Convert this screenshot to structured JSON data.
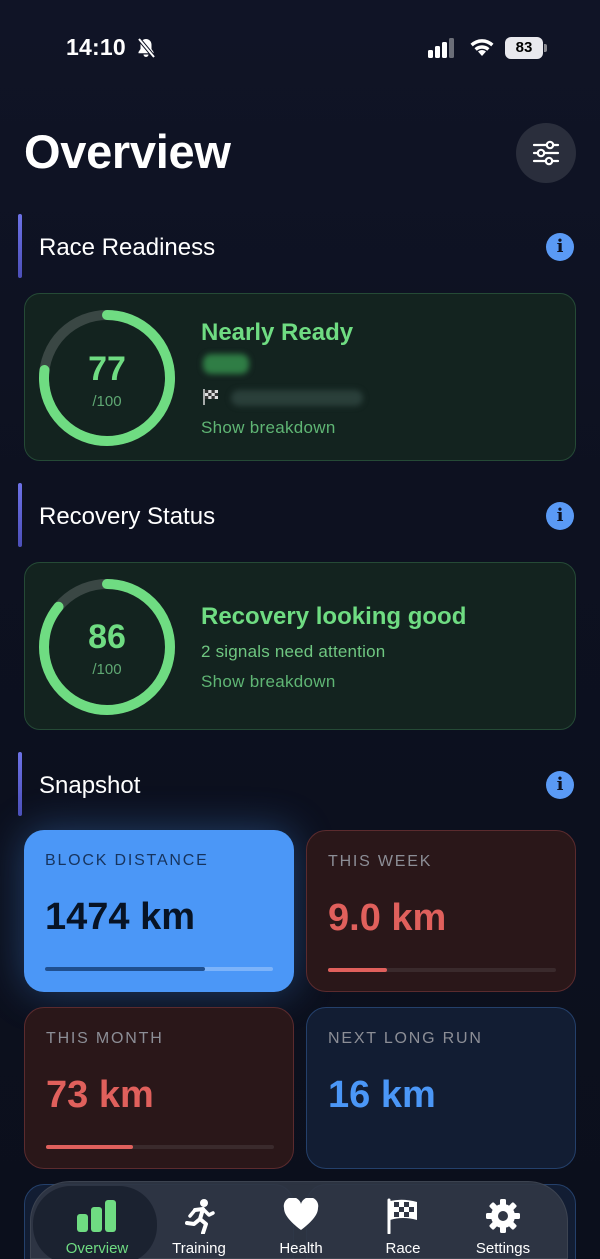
{
  "status_bar": {
    "time": "14:10",
    "battery": "83"
  },
  "header": {
    "title": "Overview"
  },
  "sections": {
    "race_readiness": "Race Readiness",
    "recovery_status": "Recovery Status",
    "snapshot": "Snapshot"
  },
  "race_card": {
    "score": "77",
    "max": "/100",
    "score_fraction": 0.77,
    "title": "Nearly Ready",
    "link": "Show breakdown"
  },
  "recovery_card": {
    "score": "86",
    "max": "/100",
    "score_fraction": 0.86,
    "title": "Recovery looking good",
    "subtitle": "2 signals need attention",
    "link": "Show breakdown"
  },
  "snapshot": {
    "block_distance": {
      "label": "BLOCK DISTANCE",
      "value": "1474 km",
      "progress": 0.7
    },
    "this_week": {
      "label": "THIS WEEK",
      "value": "9.0 km",
      "progress": 0.26
    },
    "this_month": {
      "label": "THIS MONTH",
      "value": "73 km",
      "progress": 0.38
    },
    "next_long_run": {
      "label": "NEXT LONG RUN",
      "value": "16 km"
    }
  },
  "tabs": [
    {
      "label": "Overview",
      "icon": "bar-chart-icon",
      "active": true
    },
    {
      "label": "Training",
      "icon": "runner-icon"
    },
    {
      "label": "Health",
      "icon": "heart-icon"
    },
    {
      "label": "Race",
      "icon": "checkered-flag-icon"
    },
    {
      "label": "Settings",
      "icon": "gear-icon"
    }
  ],
  "colors": {
    "accent_green": "#6fdc82",
    "accent_blue": "#4b97f7",
    "accent_red": "#e0605c",
    "background": "#0d1120"
  }
}
